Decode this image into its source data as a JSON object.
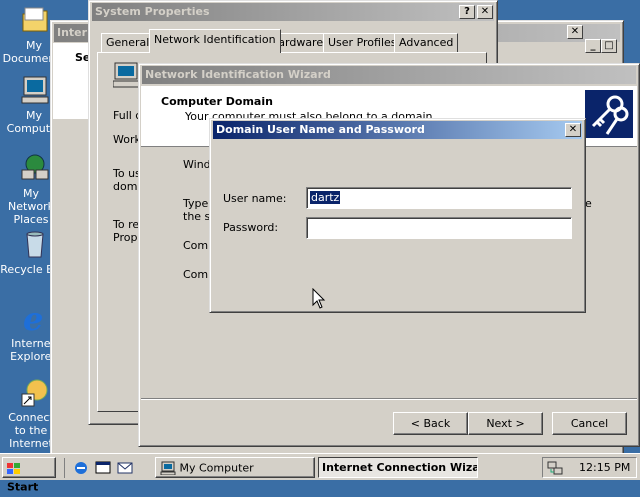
{
  "desktop": {
    "icons": [
      {
        "label": "My Documents",
        "icon": "folder-icon"
      },
      {
        "label": "My Computer",
        "icon": "computer-icon"
      },
      {
        "label": "My Network Places",
        "icon": "network-icon"
      },
      {
        "label": "Recycle Bin",
        "icon": "recycle-bin-icon"
      },
      {
        "label": "Internet Explorer",
        "icon": "ie-icon"
      },
      {
        "label": "Connect to the Internet",
        "icon": "connect-icon"
      }
    ]
  },
  "background_window": {
    "title": "Internet"
  },
  "system_properties": {
    "title": "System Properties",
    "tabs": [
      "General",
      "Network Identification",
      "Hardware",
      "User Profiles",
      "Advanced"
    ],
    "active_tab": "Network Identification",
    "partial_texts": [
      "Full c",
      "Work",
      "To us",
      "doma",
      "To re",
      "Prope"
    ]
  },
  "wizard": {
    "title": "Network Identification Wizard",
    "header_title": "Computer Domain",
    "header_subtitle": "Your computer must also belong to a domain.",
    "partial_texts": [
      "Windo",
      "Type",
      "the sa",
      "Compu",
      "Compu",
      "e"
    ],
    "buttons": {
      "back": "< Back",
      "next": "Next >",
      "cancel": "Cancel"
    }
  },
  "dialog": {
    "title": "Domain User Name and Password",
    "username_label": "User name:",
    "username_value": "dartz",
    "password_label": "Password:",
    "password_value": ""
  },
  "taskbar": {
    "start_label": "Start",
    "tasks": [
      {
        "label": "My Computer",
        "icon": "computer-icon"
      },
      {
        "label": "Internet Connection Wiza...",
        "icon": "wizard-icon"
      }
    ],
    "clock": "12:15 PM"
  },
  "colors": {
    "desktop": "#3a6ea5",
    "title_active": "#0a246a",
    "selection": "#0a246a",
    "face": "#d4d0c8"
  }
}
